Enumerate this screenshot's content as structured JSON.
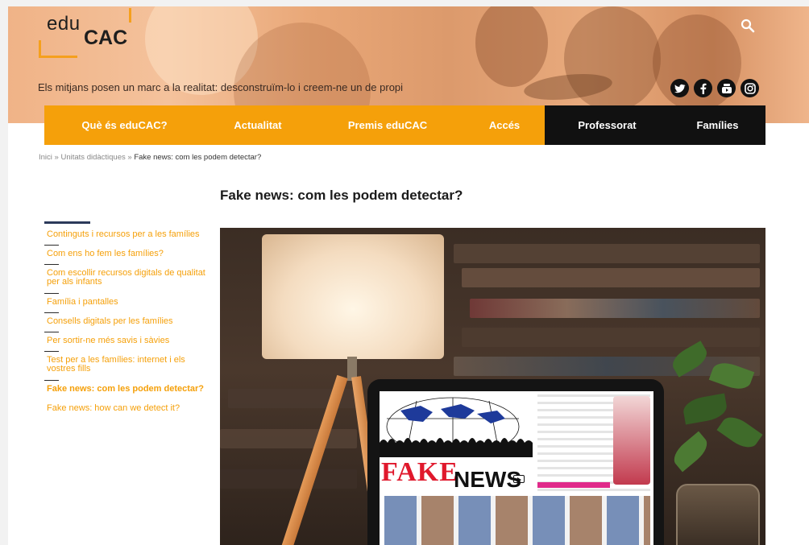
{
  "header": {
    "logo_edu": "edu",
    "logo_cac": "CAC",
    "tagline": "Els mitjans posen un marc a la realitat: desconstruïm-lo i creem-ne un de propi",
    "search_icon": "search-icon",
    "socials": [
      "twitter-icon",
      "facebook-icon",
      "youtube-icon",
      "instagram-icon"
    ]
  },
  "nav": {
    "items": [
      {
        "label": "Què és eduCAC?"
      },
      {
        "label": "Actualitat"
      },
      {
        "label": "Premis eduCAC"
      },
      {
        "label": "Accés"
      },
      {
        "label": "Professorat"
      },
      {
        "label": "Famílies"
      }
    ]
  },
  "breadcrumb": {
    "home": "Inici",
    "separator": "»",
    "section": "Unitats didàctiques",
    "current": "Fake news: com les podem detectar?"
  },
  "page": {
    "title": "Fake news: com les podem detectar?"
  },
  "sidebar": {
    "items": [
      {
        "label": "Continguts i recursos per a les famílies"
      },
      {
        "label": "Com ens ho fem les famílies?"
      },
      {
        "label": "Com escollir recursos digitals de qualitat per als infants"
      },
      {
        "label": "Família i pantalles"
      },
      {
        "label": "Consells digitals per les famílies"
      },
      {
        "label": "Per sortir-ne més savis i sàvies"
      },
      {
        "label": "Test per a les famílies: internet i els vostres fills"
      },
      {
        "label": "Fake news: com les podem detectar?"
      },
      {
        "label": "Fake news: how can we detect it?"
      }
    ]
  },
  "hero": {
    "screen_fake": "FAKE",
    "screen_news": "NEWS"
  },
  "colors": {
    "accent": "#f5a00a",
    "nav_dark": "#111111",
    "sidebar_rule": "#2c3a5a"
  }
}
